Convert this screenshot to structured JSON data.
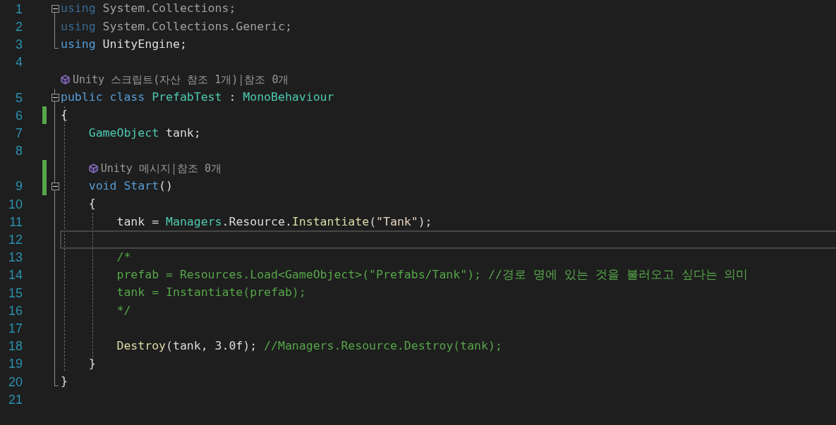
{
  "editor": {
    "rows": [
      {
        "kind": "code",
        "number": "1",
        "fold": {
          "kind": "start",
          "expanded": true
        },
        "changed": false,
        "current": false,
        "tokens": [
          {
            "text": "using",
            "kind": "dimkeyword"
          },
          {
            "text": " System.Collections;",
            "kind": "dim"
          }
        ]
      },
      {
        "kind": "code",
        "number": "2",
        "fold": {
          "kind": "inside"
        },
        "changed": false,
        "current": false,
        "tokens": [
          {
            "text": "using",
            "kind": "dimkeyword"
          },
          {
            "text": " System.Collections.Generic;",
            "kind": "dim"
          }
        ]
      },
      {
        "kind": "code",
        "number": "3",
        "fold": {
          "kind": "end"
        },
        "changed": false,
        "current": false,
        "tokens": [
          {
            "text": "using",
            "kind": "keyword"
          },
          {
            "text": " UnityEngine;",
            "kind": "plain"
          }
        ]
      },
      {
        "kind": "code",
        "number": "4",
        "changed": false,
        "current": false,
        "tokens": []
      },
      {
        "kind": "codelens",
        "changed": false,
        "current": false,
        "parts": [
          "Unity 스크립트(자산 참조 1개)",
          "|",
          "참조 0개"
        ]
      },
      {
        "kind": "code",
        "number": "5",
        "fold": {
          "kind": "start",
          "expanded": true
        },
        "changed": false,
        "current": false,
        "tokens": [
          {
            "text": "public class ",
            "kind": "keyword"
          },
          {
            "text": "PrefabTest",
            "kind": "type"
          },
          {
            "text": " : ",
            "kind": "plain"
          },
          {
            "text": "MonoBehaviour",
            "kind": "type"
          }
        ]
      },
      {
        "kind": "code",
        "number": "6",
        "fold": {
          "kind": "inside"
        },
        "changed": true,
        "current": false,
        "tokens": [
          {
            "text": "{",
            "kind": "plain"
          }
        ]
      },
      {
        "kind": "code",
        "number": "7",
        "fold": {
          "kind": "inside"
        },
        "changed": false,
        "current": false,
        "tokens": [
          {
            "text": "    GameObject",
            "kind": "type"
          },
          {
            "text": " tank;",
            "kind": "plain"
          }
        ]
      },
      {
        "kind": "code",
        "number": "8",
        "fold": {
          "kind": "inside"
        },
        "changed": false,
        "current": false,
        "tokens": []
      },
      {
        "kind": "codelens",
        "fold": {
          "kind": "inside"
        },
        "changed": true,
        "current": false,
        "parts": [
          "Unity 메시지",
          "|",
          "참조 0개"
        ]
      },
      {
        "kind": "code",
        "number": "9",
        "fold": {
          "kind": "start",
          "expanded": true
        },
        "changed": true,
        "current": false,
        "tokens": [
          {
            "text": "    void ",
            "kind": "keyword"
          },
          {
            "text": "Start",
            "kind": "keyword"
          },
          {
            "text": "()",
            "kind": "plain"
          }
        ]
      },
      {
        "kind": "code",
        "number": "10",
        "fold": {
          "kind": "inside"
        },
        "changed": false,
        "current": false,
        "tokens": [
          {
            "text": "    {",
            "kind": "plain"
          }
        ]
      },
      {
        "kind": "code",
        "number": "11",
        "fold": {
          "kind": "inside"
        },
        "changed": false,
        "current": false,
        "tokens": [
          {
            "text": "        tank = ",
            "kind": "plain"
          },
          {
            "text": "Managers",
            "kind": "type"
          },
          {
            "text": ".Resource.",
            "kind": "plain"
          },
          {
            "text": "Instantiate",
            "kind": "method"
          },
          {
            "text": "(",
            "kind": "plain"
          },
          {
            "text": "\"Tank\"",
            "kind": "string"
          },
          {
            "text": ");",
            "kind": "plain"
          }
        ]
      },
      {
        "kind": "code",
        "number": "12",
        "fold": {
          "kind": "inside"
        },
        "changed": false,
        "current": true,
        "tokens": []
      },
      {
        "kind": "code",
        "number": "13",
        "fold": {
          "kind": "inside"
        },
        "changed": false,
        "current": false,
        "tokens": [
          {
            "text": "        /*",
            "kind": "comment"
          }
        ]
      },
      {
        "kind": "code",
        "number": "14",
        "fold": {
          "kind": "inside"
        },
        "changed": false,
        "current": false,
        "tokens": [
          {
            "text": "        prefab = Resources.Load<GameObject>(\"Prefabs/Tank\"); //경로 명에 있는 것을 불러오고 싶다는 의미",
            "kind": "comment"
          }
        ]
      },
      {
        "kind": "code",
        "number": "15",
        "fold": {
          "kind": "inside"
        },
        "changed": false,
        "current": false,
        "tokens": [
          {
            "text": "        tank = Instantiate(prefab);",
            "kind": "comment"
          }
        ]
      },
      {
        "kind": "code",
        "number": "16",
        "fold": {
          "kind": "inside"
        },
        "changed": false,
        "current": false,
        "tokens": [
          {
            "text": "        */",
            "kind": "comment"
          }
        ]
      },
      {
        "kind": "code",
        "number": "17",
        "fold": {
          "kind": "inside"
        },
        "changed": false,
        "current": false,
        "tokens": []
      },
      {
        "kind": "code",
        "number": "18",
        "fold": {
          "kind": "inside"
        },
        "changed": false,
        "current": false,
        "tokens": [
          {
            "text": "        Destroy",
            "kind": "method"
          },
          {
            "text": "(tank, 3.0f); ",
            "kind": "plain"
          },
          {
            "text": "//Managers.Resource.Destroy(tank);",
            "kind": "comment"
          }
        ]
      },
      {
        "kind": "code",
        "number": "19",
        "fold": {
          "kind": "inside"
        },
        "changed": false,
        "current": false,
        "tokens": [
          {
            "text": "    }",
            "kind": "plain"
          }
        ]
      },
      {
        "kind": "code",
        "number": "20",
        "fold": {
          "kind": "end"
        },
        "changed": false,
        "current": false,
        "tokens": [
          {
            "text": "}",
            "kind": "plain"
          }
        ]
      },
      {
        "kind": "code",
        "number": "21",
        "changed": false,
        "current": false,
        "tokens": []
      }
    ]
  }
}
